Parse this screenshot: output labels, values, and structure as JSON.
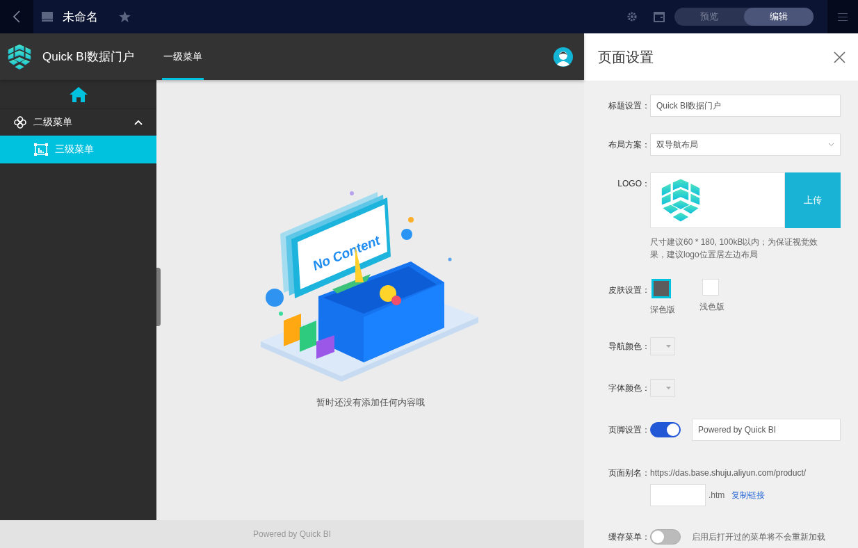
{
  "topbar": {
    "title": "未命名",
    "toggle": [
      {
        "label": "预览",
        "selected": false
      },
      {
        "label": "编辑",
        "selected": true
      }
    ]
  },
  "preview": {
    "brand": "Quick BI数据门户",
    "nav_tabs": [
      {
        "label": "一级菜单",
        "selected": true
      }
    ],
    "sidebar": {
      "items": [
        {
          "label": "二级菜单",
          "expanded": true,
          "children": [
            {
              "label": "三级菜单",
              "selected": true
            }
          ]
        }
      ]
    },
    "illustration_text": "No Content",
    "empty_text": "暂时还没有添加任何内容哦",
    "footer": "Powered by Quick BI"
  },
  "settings": {
    "title": "页面设置",
    "fields": [
      {
        "kind": "text",
        "label": "标题设置：",
        "value": "Quick BI数据门户"
      },
      {
        "kind": "select",
        "label": "布局方案：",
        "value": "双导航布局"
      },
      {
        "kind": "logo",
        "label": "LOGO：",
        "button": "上传",
        "hint": "尺寸建议60 * 180, 100kB以内；为保证视觉效果，建议logo位置居左边布局"
      },
      {
        "kind": "skin",
        "label": "皮肤设置：",
        "options": [
          {
            "label": "深色版",
            "color": "#5c5c5c",
            "selected": true
          },
          {
            "label": "浅色版",
            "color": "#ffffff",
            "selected": false
          }
        ]
      },
      {
        "kind": "color",
        "label": "导航颜色："
      },
      {
        "kind": "color",
        "label": "字体颜色："
      },
      {
        "kind": "switch",
        "label": "页脚设置：",
        "on": true,
        "value": "Powered by Quick BI"
      },
      {
        "kind": "alias",
        "label": "页面别名：",
        "url": "https://das.base.shuju.aliyun.com/product/",
        "suffix": ".htm",
        "link": "复制链接"
      },
      {
        "kind": "switch",
        "label": "缓存菜单：",
        "on": false,
        "note": "启用后打开过的菜单将不会重新加载"
      }
    ]
  }
}
